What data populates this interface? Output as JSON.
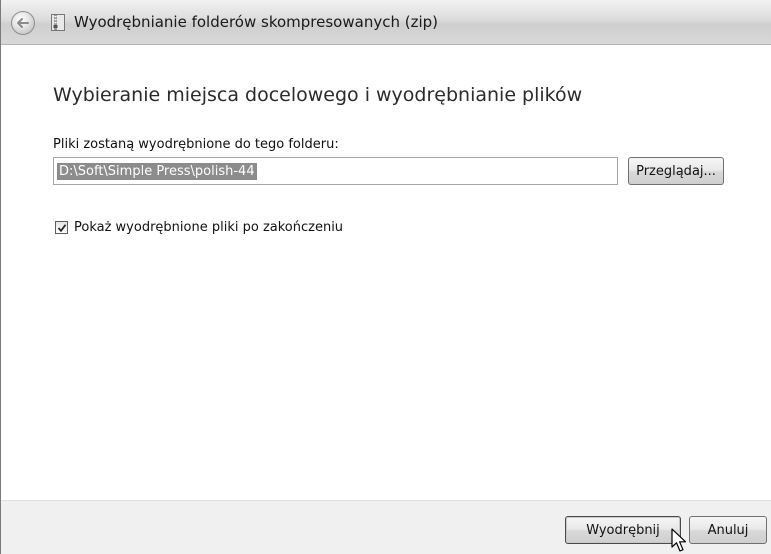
{
  "window": {
    "title": "Wyodrębnianie folderów skompresowanych (zip)"
  },
  "content": {
    "heading": "Wybieranie miejsca docelowego i wyodrębnianie plików",
    "destination_label": "Pliki zostaną wyodrębnione do tego folderu:",
    "destination_path": "D:\\Soft\\Simple Press\\polish-44",
    "browse_label": "Przeglądaj...",
    "show_files_label": "Pokaż wyodrębnione pliki po zakończeniu",
    "show_files_checked": true
  },
  "footer": {
    "extract_label": "Wyodrębnij",
    "cancel_label": "Anuluj"
  },
  "icons": {
    "back": "back-arrow-icon",
    "title": "zip-folder-icon",
    "check": "checkmark-icon",
    "cursor": "mouse-pointer-icon"
  }
}
